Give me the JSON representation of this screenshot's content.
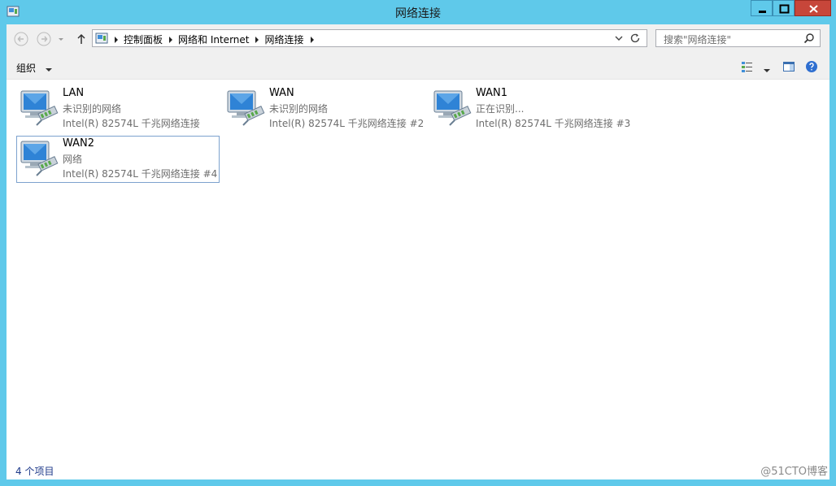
{
  "window": {
    "title": "网络连接"
  },
  "address": {
    "crumbs": [
      "控制面板",
      "网络和 Internet",
      "网络连接"
    ]
  },
  "search": {
    "placeholder": "搜索\"网络连接\""
  },
  "toolbar": {
    "organize_label": "组织"
  },
  "items": [
    {
      "name": "LAN",
      "status": "未识别的网络",
      "adapter": "Intel(R) 82574L 千兆网络连接"
    },
    {
      "name": "WAN",
      "status": "未识别的网络",
      "adapter": "Intel(R) 82574L 千兆网络连接 #2"
    },
    {
      "name": "WAN1",
      "status": "正在识别...",
      "adapter": "Intel(R) 82574L 千兆网络连接 #3"
    },
    {
      "name": "WAN2",
      "status": "网络",
      "adapter": "Intel(R) 82574L 千兆网络连接 #4"
    }
  ],
  "status": {
    "count_text": "4 个项目"
  },
  "watermark": "@51CTO博客",
  "colors": {
    "frame": "#5fc9ea",
    "close": "#c7463a",
    "selection": "#7da2ce",
    "status_text": "#1e3a8a"
  }
}
